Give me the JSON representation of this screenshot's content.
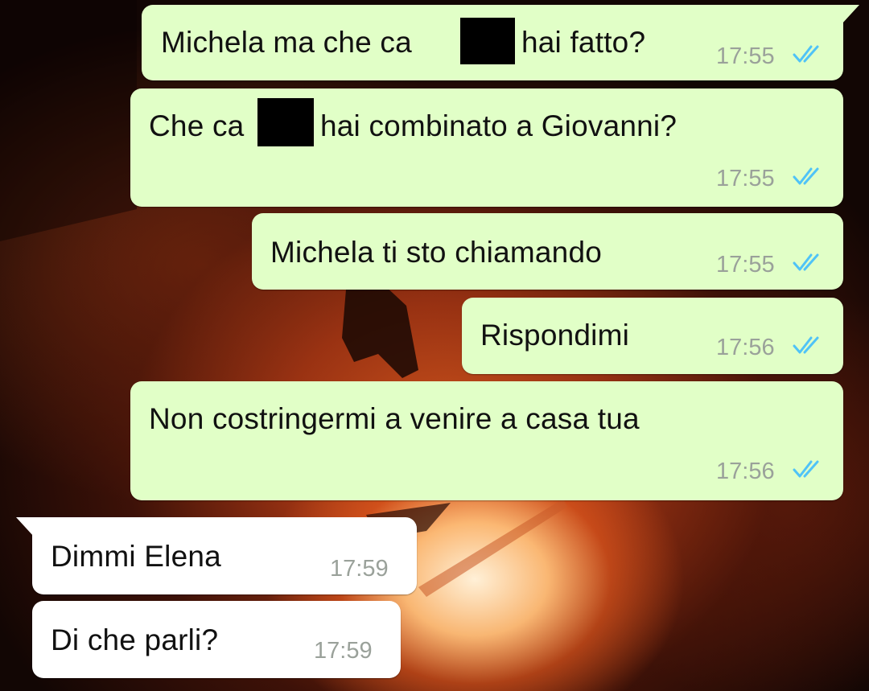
{
  "chat": {
    "messages": [
      {
        "direction": "out",
        "pre": "Michela ma che ca",
        "post": "hai fatto?",
        "redacted": true,
        "time": "17:55",
        "status": "read"
      },
      {
        "direction": "out",
        "pre": "Che ca",
        "post": "hai combinato a Giovanni?",
        "redacted": true,
        "time": "17:55",
        "status": "read"
      },
      {
        "direction": "out",
        "text": "Michela ti sto chiamando",
        "time": "17:55",
        "status": "read"
      },
      {
        "direction": "out",
        "text": "Rispondimi",
        "time": "17:56",
        "status": "read"
      },
      {
        "direction": "out",
        "text": "Non costringermi a venire a casa tua",
        "time": "17:56",
        "status": "read"
      },
      {
        "direction": "in",
        "text": "Dimmi Elena",
        "time": "17:59"
      },
      {
        "direction": "in",
        "text": "Di che parli?",
        "time": "17:59"
      }
    ]
  },
  "colors": {
    "outgoing_bubble": "#e1ffc7",
    "incoming_bubble": "#ffffff",
    "read_ticks": "#4fc3f7",
    "timestamp": "#9aa19a"
  },
  "icons": {
    "read_status": "double-check-icon"
  }
}
